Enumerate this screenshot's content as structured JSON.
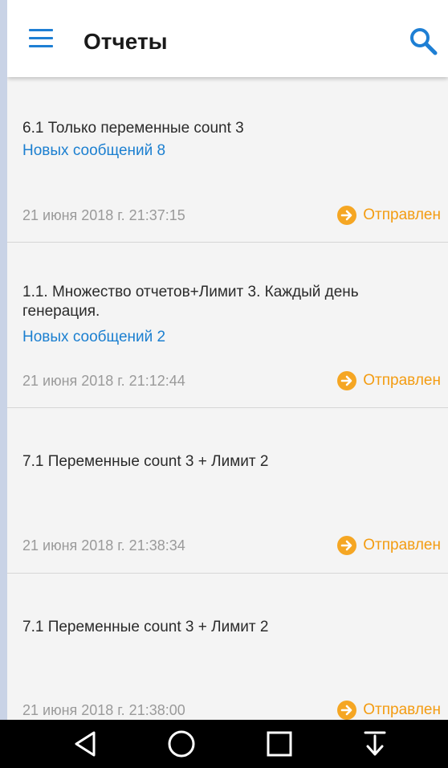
{
  "header": {
    "title": "Отчеты",
    "menu_icon": "hamburger-menu-icon",
    "search_icon": "search-icon",
    "accent_color": "#1e7fd4"
  },
  "reports": [
    {
      "title": "6.1 Только переменные count 3",
      "new_messages": "Новых сообщений 8",
      "date": "21 июня 2018 г. 21:37:15",
      "status": "Отправлен"
    },
    {
      "title": "1.1. Множество отчетов+Лимит 3. Каждый день генерация.",
      "new_messages": "Новых сообщений 2",
      "date": "21 июня 2018 г. 21:12:44",
      "status": "Отправлен"
    },
    {
      "title": "7.1 Переменные count 3 + Лимит 2",
      "new_messages": "",
      "date": "21 июня 2018 г. 21:38:34",
      "status": "Отправлен"
    },
    {
      "title": "7.1 Переменные count 3 + Лимит 2",
      "new_messages": "",
      "date": "21 июня 2018 г. 21:38:00",
      "status": "Отправлен"
    }
  ],
  "status_color": "#f39c12",
  "navbar": {
    "buttons": [
      "back-triangle-icon",
      "home-circle-icon",
      "recents-square-icon",
      "download-arrow-icon"
    ]
  }
}
